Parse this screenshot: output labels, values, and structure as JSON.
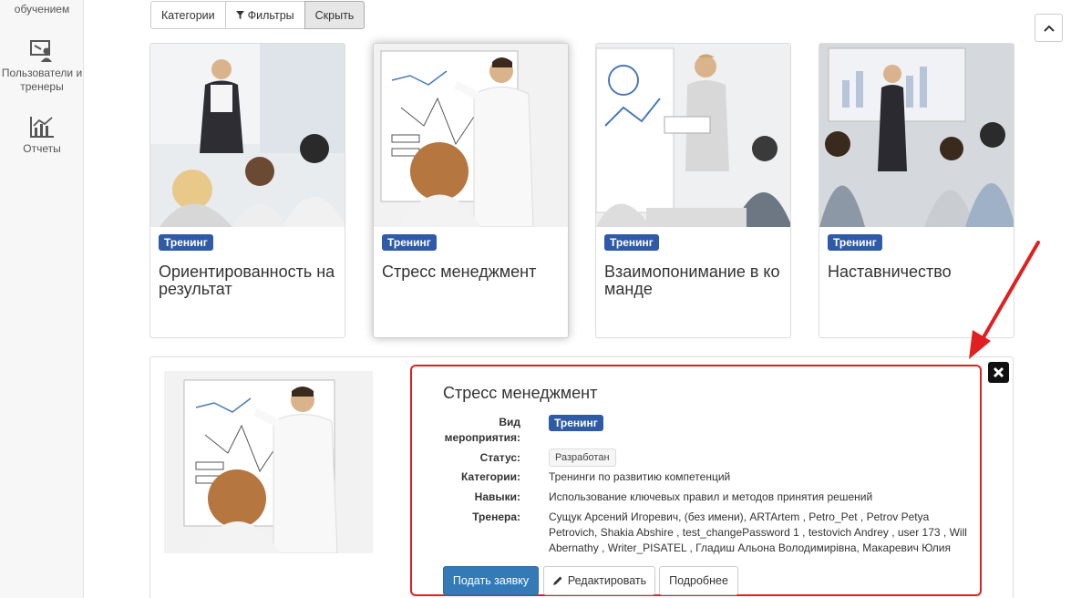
{
  "sidebar": {
    "items": [
      {
        "label": "обучением",
        "icon": "book-icon"
      },
      {
        "label": "Пользователи и тренеры",
        "icon": "users-presentation-icon"
      },
      {
        "label": "Отчеты",
        "icon": "chart-icon"
      }
    ]
  },
  "toolbar": {
    "categories_label": "Категории",
    "filters_label": "Фильтры",
    "hide_label": "Скрыть"
  },
  "cards": [
    {
      "badge": "Тренинг",
      "title": "Ориентированность на результат"
    },
    {
      "badge": "Тренинг",
      "title": "Стресс менеджмент"
    },
    {
      "badge": "Тренинг",
      "title": "Взаимопонимание в ко манде"
    },
    {
      "badge": "Тренинг",
      "title": "Наставничество"
    }
  ],
  "detail": {
    "title": "Стресс менеджмент",
    "type_label": "Вид мероприятия:",
    "type_value": "Тренинг",
    "status_label": "Статус:",
    "status_value": "Разработан",
    "categories_label": "Категории:",
    "categories_value": "Тренинги по развитию компетенций",
    "skills_label": "Навыки:",
    "skills_value": "Использование ключевых правил и методов принятия решений",
    "trainers_label": "Тренера:",
    "trainers_value": "Сущук Арсений Игоревич, (без имени), ARTArtem , Petro_Pet , Petrov Petya Petrovich, Shakia Abshire , test_changePassword 1 , testovich Andrey , user 173 , Will Abernathy , Writer_PISATEL , Гладиш Альона Володимирівна, Макаревич Юлия",
    "apply_label": "Подать заявку",
    "edit_label": "Редактировать",
    "more_label": "Подробнее"
  },
  "colors": {
    "badge": "#2f5aa8",
    "primary": "#337ab7",
    "highlight": "#e02020"
  }
}
